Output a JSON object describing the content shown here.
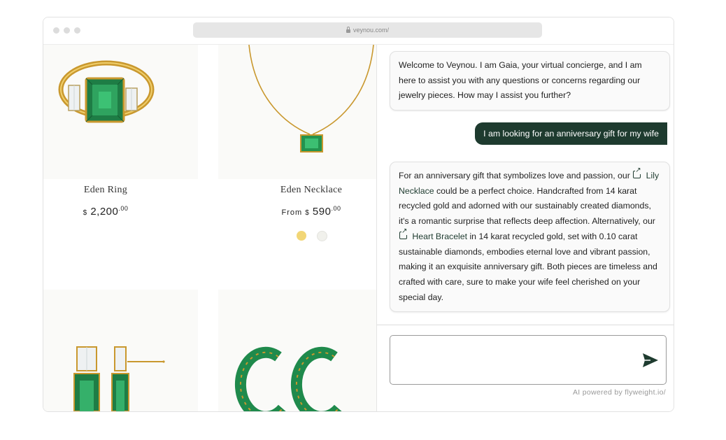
{
  "browser": {
    "url": "veynou.com/"
  },
  "products": [
    {
      "name": "Eden Ring",
      "currency": "$",
      "price": "2,200",
      "cents": ".00",
      "prefix": ""
    },
    {
      "name": "Eden Necklace",
      "currency": "$",
      "price": "590",
      "cents": ".00",
      "prefix": "From"
    }
  ],
  "swatches": {
    "gold": "#f2d676",
    "white": "#f1f1ec"
  },
  "chat": {
    "welcome": "Welcome to Veynou. I am Gaia, your virtual concierge, and I am here to assist you with any questions or concerns regarding our jewelry pieces. How may I assist you further?",
    "user_message": "I am looking for an anniversary gift for my wife",
    "reply": {
      "part1": "For an anniversary gift that symbolizes love and passion, our",
      "link1": "Lily Necklace",
      "part2": "could be a perfect choice. Handcrafted from 14 karat recycled gold and adorned with our sustainably created diamonds, it's a romantic surprise that reflects deep affection. Alternatively, our",
      "link2": "Heart Bracelet",
      "part3": "in 14 karat recycled gold, set with 0.10 carat sustainable diamonds, embodies eternal love and vibrant passion, making it an exquisite anniversary gift. Both pieces are timeless and crafted with care, sure to make your wife feel cherished on your special day."
    },
    "input_value": "",
    "powered_by": "AI powered by flyweight.io/"
  },
  "colors": {
    "accent": "#1e3b2f",
    "emerald": "#1f8a4c",
    "gold": "#d4a93c"
  }
}
